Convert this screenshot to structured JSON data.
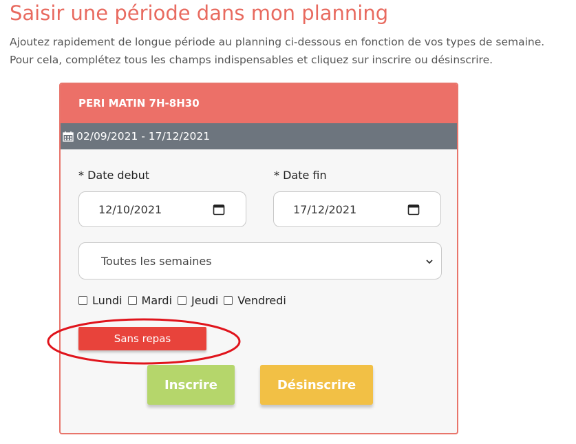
{
  "page": {
    "title": "Saisir une période dans mon planning",
    "intro_line1": "Ajoutez rapidement de longue période au planning ci-dessous en fonction de vos types de semaine.",
    "intro_line2": "Pour cela, complétez tous les champs indispensables et cliquez sur inscrire ou désinscrire."
  },
  "card": {
    "header": "PERI MATIN 7H-8H30",
    "period": "02/09/2021 - 17/12/2021",
    "date_start_label": "* Date debut",
    "date_start_value": "12/10/2021",
    "date_end_label": "* Date fin",
    "date_end_value": "17/12/2021",
    "week_type_selected": "Toutes les semaines",
    "days": [
      {
        "label": "Lundi",
        "checked": false
      },
      {
        "label": "Mardi",
        "checked": false
      },
      {
        "label": "Jeudi",
        "checked": false
      },
      {
        "label": "Vendredi",
        "checked": false
      }
    ],
    "sans_repas_label": "Sans repas",
    "inscrire_label": "Inscrire",
    "desinscrire_label": "Désinscrire"
  },
  "colors": {
    "title": "#e86a5f",
    "header": "#ec7068",
    "subheader": "#6d757e",
    "sans_repas": "#e8433b",
    "inscrire": "#b5d66b",
    "desinscrire": "#f2c045",
    "highlight": "#e0141c"
  }
}
